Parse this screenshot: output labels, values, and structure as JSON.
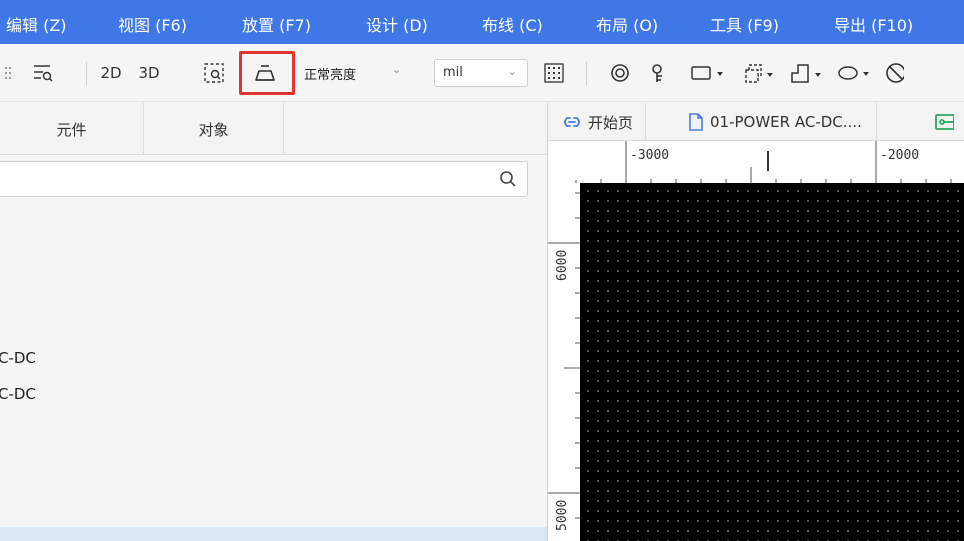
{
  "menubar": {
    "items": [
      "编辑 (Z)",
      "视图 (F6)",
      "放置 (F7)",
      "设计 (D)",
      "布线 (C)",
      "布局 (O)",
      "工具 (F9)",
      "导出 (F10)"
    ]
  },
  "toolbar": {
    "view_2d": "2D",
    "view_3d": "3D",
    "brightness": "正常亮度",
    "unit": "mil"
  },
  "left_panel": {
    "tabs": [
      "元件",
      "对象"
    ],
    "search": {
      "value": "",
      "placeholder": ""
    },
    "items": [
      "C-DC",
      "C-DC"
    ]
  },
  "doc_tabs": {
    "start": "开始页",
    "file": "01-POWER AC-DC...."
  },
  "ruler": {
    "top_labels": [
      "-3000",
      "-2000"
    ],
    "left_labels": [
      "6000",
      "5000"
    ]
  },
  "colors": {
    "menubar": "#3f77e6",
    "highlight": "#e3342f",
    "canvas": "#000000"
  }
}
